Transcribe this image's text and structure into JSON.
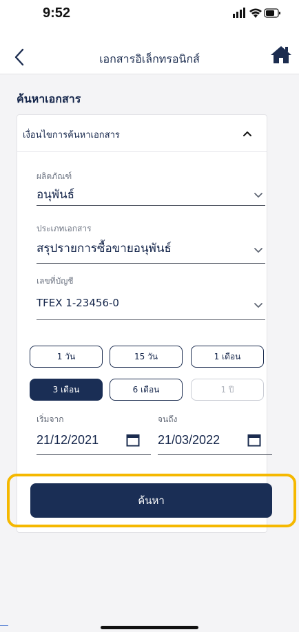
{
  "status_bar": {
    "time": "9:52",
    "icons": [
      "signal-icon",
      "wifi-icon",
      "battery-icon"
    ]
  },
  "nav": {
    "title": "เอกสารอิเล็กทรอนิกส์",
    "back_icon": "chevron-left-icon",
    "home_icon": "home-icon"
  },
  "section_title": "ค้นหาเอกสาร",
  "filter_panel": {
    "header": "เงื่อนไขการค้นหาเอกสาร",
    "collapse_icon": "chevron-up-icon",
    "product": {
      "label": "ผลิตภัณฑ์",
      "value": "อนุพันธ์"
    },
    "document_type": {
      "label": "ประเภทเอกสาร",
      "value": "สรุปรายการซื้อขายอนุพันธ์"
    },
    "account": {
      "label": "เลขที่บัญชี",
      "value": "TFEX 1-23456-0"
    },
    "ranges": [
      {
        "label": "1 วัน",
        "state": "normal"
      },
      {
        "label": "15 วัน",
        "state": "normal"
      },
      {
        "label": "1 เดือน",
        "state": "normal"
      },
      {
        "label": "3 เดือน",
        "state": "selected"
      },
      {
        "label": "6 เดือน",
        "state": "normal"
      },
      {
        "label": "1 ปี",
        "state": "disabled"
      }
    ],
    "start_date": {
      "label": "เริ่มจาก",
      "value": "21/12/2021"
    },
    "end_date": {
      "label": "จนถึง",
      "value": "21/03/2022"
    },
    "search_label": "ค้นหา"
  },
  "colors": {
    "primary": "#1a2e55",
    "highlight": "#f5b800",
    "background": "#f4f4f6"
  }
}
